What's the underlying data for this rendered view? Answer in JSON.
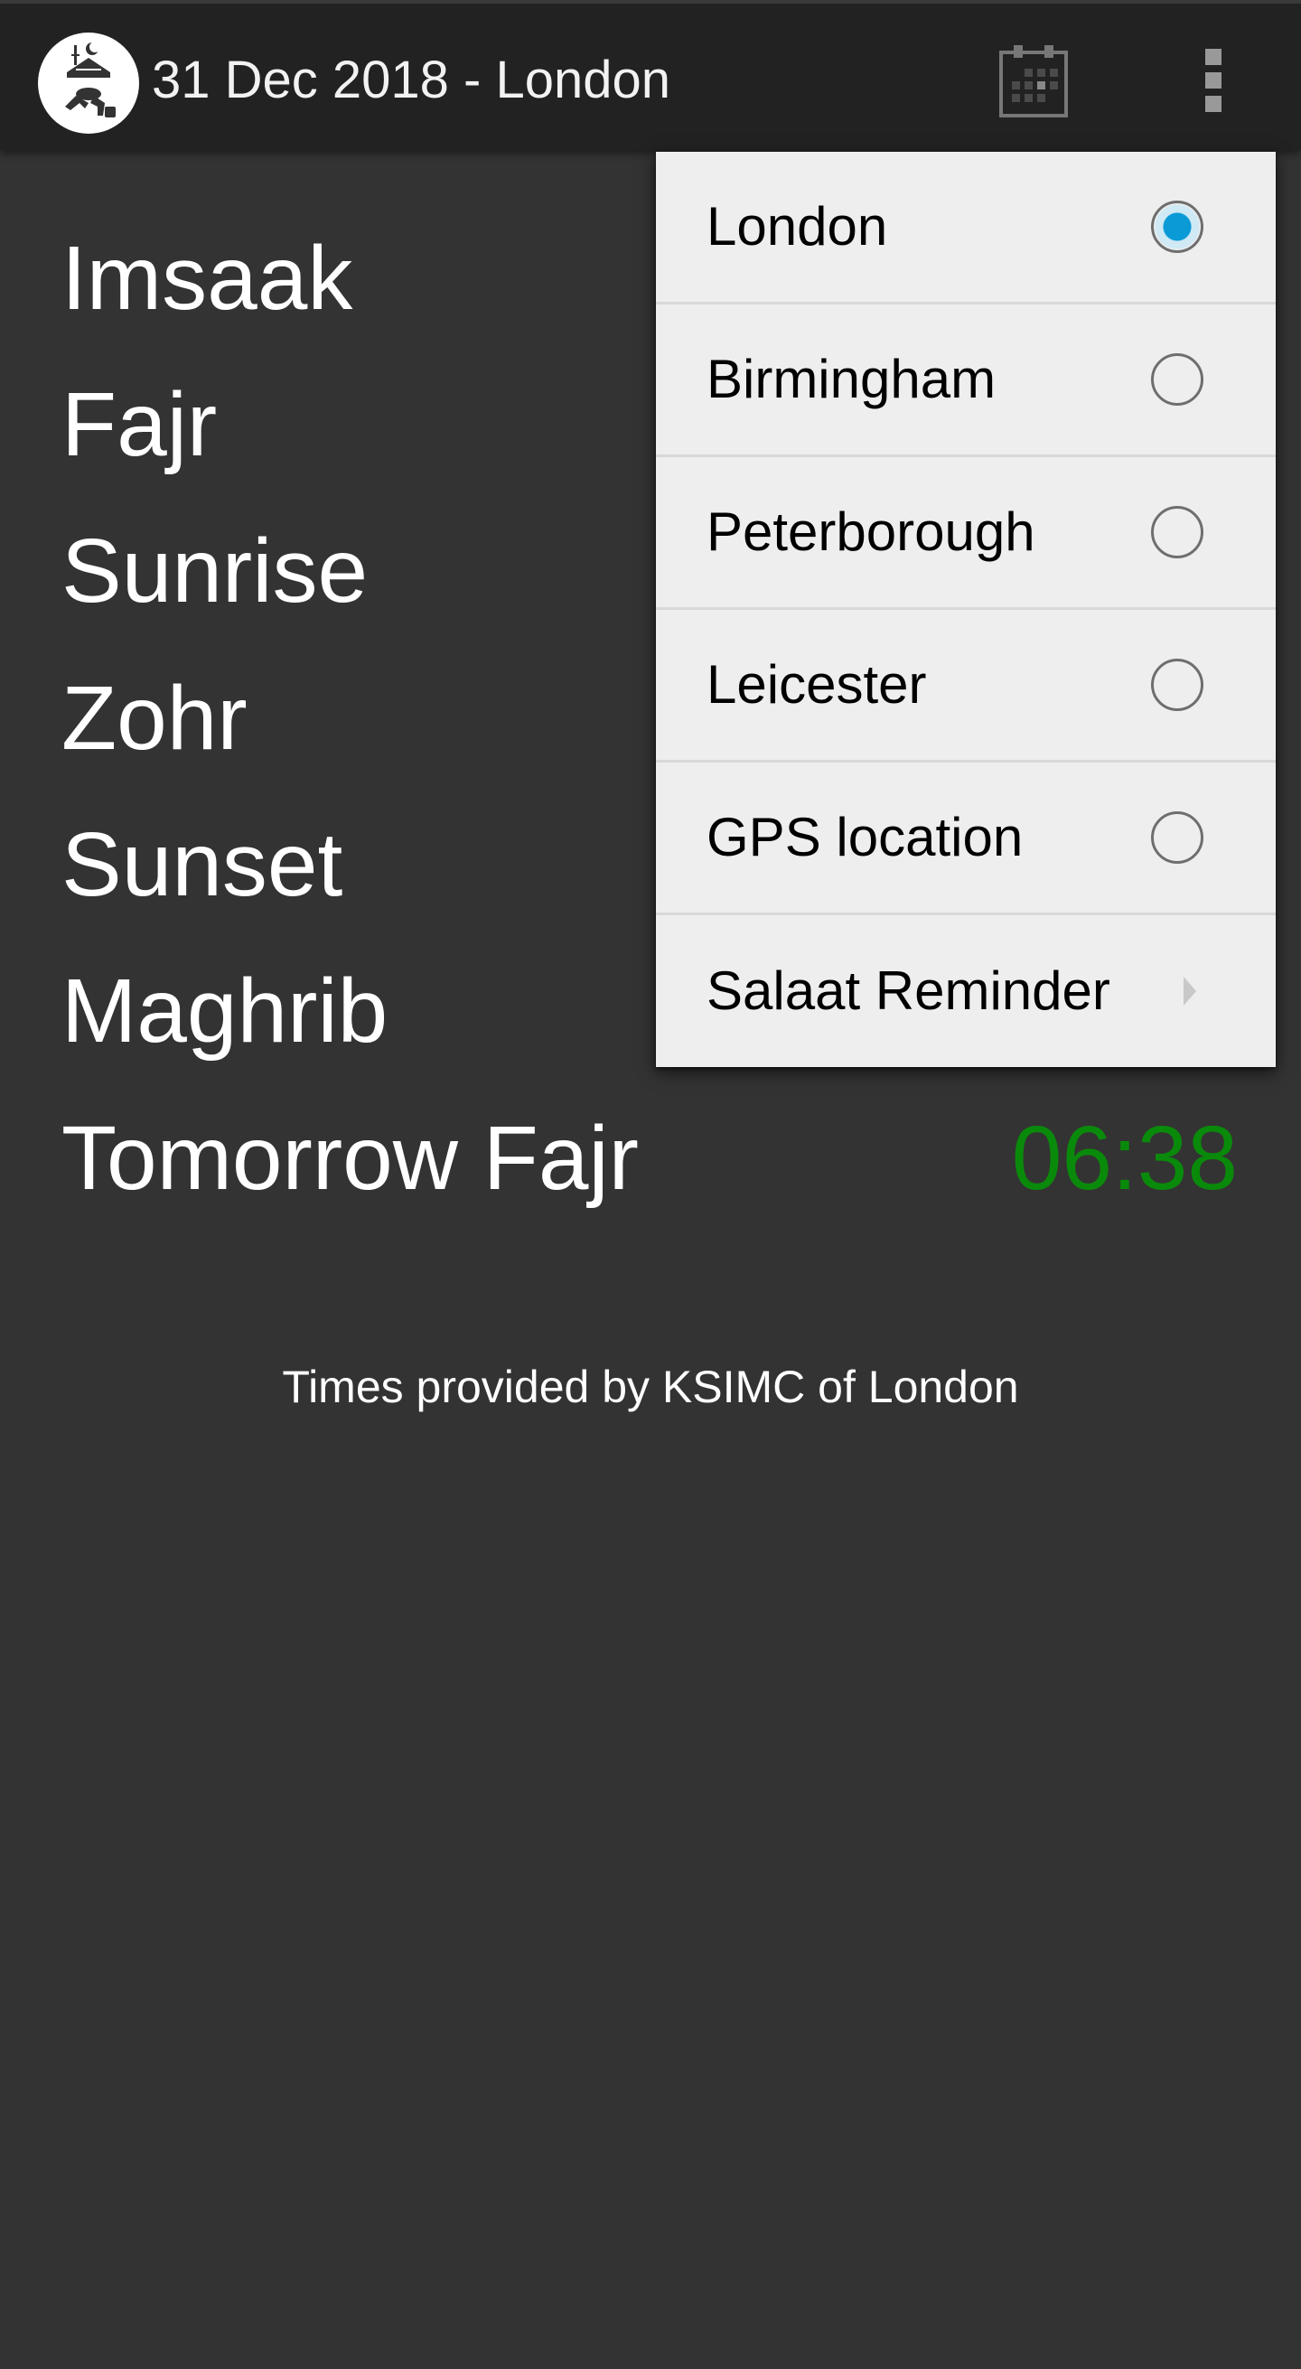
{
  "actionbar": {
    "title": "31 Dec 2018 - London",
    "logo_icon": "mosque-prayer-logo-icon",
    "calendar_icon": "calendar-icon",
    "overflow_icon": "overflow-menu-icon"
  },
  "prayers": [
    {
      "name": "Imsaak",
      "time": ""
    },
    {
      "name": "Fajr",
      "time": ""
    },
    {
      "name": "Sunrise",
      "time": ""
    },
    {
      "name": "Zohr",
      "time": ""
    },
    {
      "name": "Sunset",
      "time": ""
    },
    {
      "name": "Maghrib",
      "time": ""
    },
    {
      "name": "Tomorrow Fajr",
      "time": "06:38"
    }
  ],
  "footer": {
    "note": "Times provided by KSIMC of London"
  },
  "menu": {
    "items": [
      {
        "label": "London",
        "type": "radio",
        "checked": true
      },
      {
        "label": "Birmingham",
        "type": "radio",
        "checked": false
      },
      {
        "label": "Peterborough",
        "type": "radio",
        "checked": false
      },
      {
        "label": "Leicester",
        "type": "radio",
        "checked": false
      },
      {
        "label": "GPS location",
        "type": "radio",
        "checked": false
      },
      {
        "label": "Salaat Reminder",
        "type": "submenu"
      }
    ]
  },
  "colors": {
    "background": "#333333",
    "actionbar": "#222222",
    "highlight_time": "#0a8a0a",
    "radio_selected": "#0a9ad6",
    "menu_background": "#eeeeee"
  }
}
